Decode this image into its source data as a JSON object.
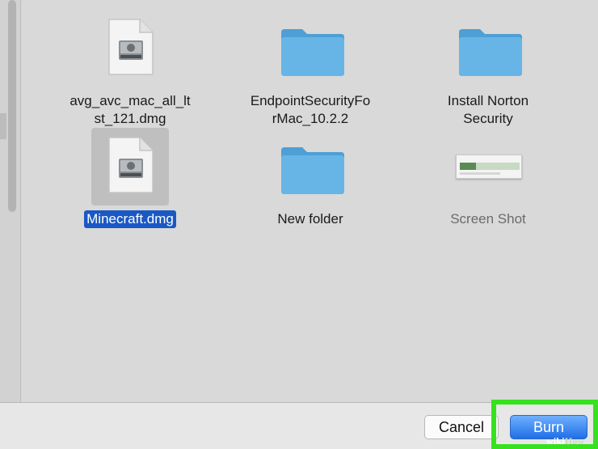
{
  "files": [
    {
      "name": "avg_avc_mac_all_lt\nst_121.dmg",
      "lines": [
        "avg_avc_mac_all_lt",
        "st_121.dmg"
      ],
      "icon": "disk-image-icon",
      "selected": false
    },
    {
      "name": "EndpointSecurityFo\nrMac_10.2.2",
      "lines": [
        "EndpointSecurityFo",
        "rMac_10.2.2"
      ],
      "icon": "folder-icon",
      "selected": false
    },
    {
      "name": "Install Norton\nSecurity",
      "lines": [
        "Install Norton",
        "Security"
      ],
      "icon": "folder-icon",
      "selected": false
    },
    {
      "name": "Minecraft.dmg",
      "lines": [
        "Minecraft.dmg"
      ],
      "icon": "disk-image-icon",
      "selected": true
    },
    {
      "name": "New folder",
      "lines": [
        "New folder"
      ],
      "icon": "folder-icon",
      "selected": false
    },
    {
      "name": "Screen Shot",
      "lines": [
        "Screen Shot"
      ],
      "icon": "screenshot-thumbnail-icon",
      "selected": false,
      "dimmed": true
    }
  ],
  "buttons": {
    "cancel_label": "Cancel",
    "burn_label": "Burn"
  },
  "watermark": {
    "wiki": "wiki",
    "how": "How"
  },
  "colors": {
    "selection": "#1a58c4",
    "folder": "#5eaee0",
    "burn_highlight": "#35e21d",
    "burn_button": "#1f6fe6"
  }
}
